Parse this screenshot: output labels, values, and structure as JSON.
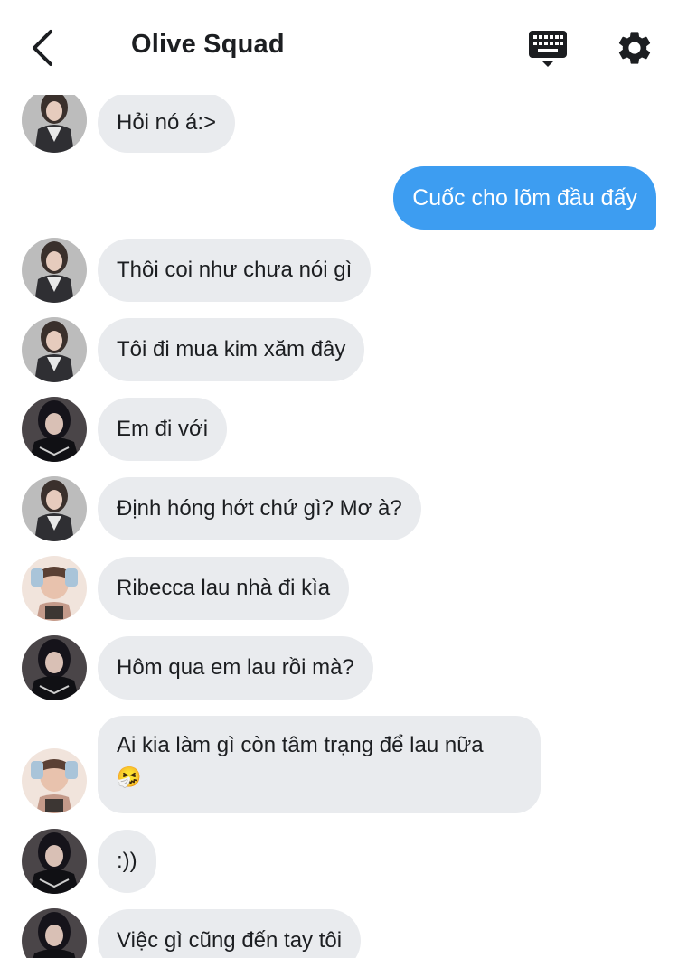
{
  "header": {
    "title": "Olive Squad",
    "back_icon": "chevron-left-icon",
    "keyboard_icon": "keyboard-icon",
    "settings_icon": "gear-icon"
  },
  "colors": {
    "incoming_bubble": "#e9ebee",
    "outgoing_bubble": "#3d9df1",
    "text": "#1c1e21"
  },
  "messages": [
    {
      "sender": "a",
      "text": "Hỏi nó á:>"
    },
    {
      "sender": "me",
      "text": "Cuốc cho lõm đầu đấy"
    },
    {
      "sender": "a",
      "text": "Thôi coi như chưa nói gì"
    },
    {
      "sender": "a",
      "text": "Tôi đi mua kim xăm đây"
    },
    {
      "sender": "b",
      "text": "Em đi với"
    },
    {
      "sender": "a",
      "text": "Định hóng hớt chứ gì? Mơ à?"
    },
    {
      "sender": "c",
      "text": "Ribecca lau nhà đi kìa"
    },
    {
      "sender": "b",
      "text": "Hôm qua em lau rồi mà?"
    },
    {
      "sender": "c",
      "text": "Ai kia làm gì còn tâm trạng để lau nữa",
      "emoji": "🤧"
    },
    {
      "sender": "b",
      "text": ":))"
    },
    {
      "sender": "b",
      "text": "Việc gì cũng đến tay tôi"
    }
  ]
}
